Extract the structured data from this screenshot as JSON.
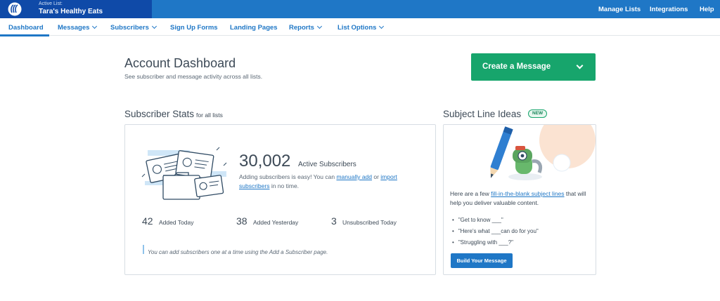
{
  "topbar": {
    "active_list_label": "Active List:",
    "active_list_name": "Tara's Healthy Eats",
    "links": [
      "Manage Lists",
      "Integrations",
      "Help"
    ]
  },
  "nav": {
    "items": [
      "Dashboard",
      "Messages",
      "Subscribers",
      "Sign Up Forms",
      "Landing Pages",
      "Reports",
      "List Options"
    ]
  },
  "header": {
    "title": "Account Dashboard",
    "subtitle": "See subscriber and message activity across all lists.",
    "create_button": "Create a Message"
  },
  "stats": {
    "heading": "Subscriber Stats",
    "heading_suffix": "for all lists",
    "active_count": "30,002",
    "active_label": "Active Subscribers",
    "add_text_before": "Adding subscribers is easy! You can ",
    "add_link_manual": "manually add",
    "add_text_or": " or ",
    "add_link_import": "import subscribers",
    "add_text_after": " in no time.",
    "added_today_num": "42",
    "added_today_label": "Added Today",
    "added_yesterday_num": "38",
    "added_yesterday_label": "Added Yesterday",
    "unsub_today_num": "3",
    "unsub_today_label": "Unsubscribed Today",
    "hint_before": "You can add subscribers one at a time using the ",
    "hint_link": "Add a Subscriber",
    "hint_after": " page."
  },
  "ideas": {
    "heading": "Subject Line Ideas",
    "badge": "NEW",
    "intro_before": "Here are a few ",
    "intro_link": "fill-in-the-blank subject lines",
    "intro_after": " that will help you deliver valuable content.",
    "items": [
      "\"Get to know ___\"",
      "\"Here's what ___can do for you\"",
      "\"Struggling with ___?\""
    ],
    "button": "Build Your Message"
  },
  "colors": {
    "brand_blue": "#1f77c6",
    "brand_dark": "#0f4aa8",
    "accent_green": "#17a56c"
  }
}
